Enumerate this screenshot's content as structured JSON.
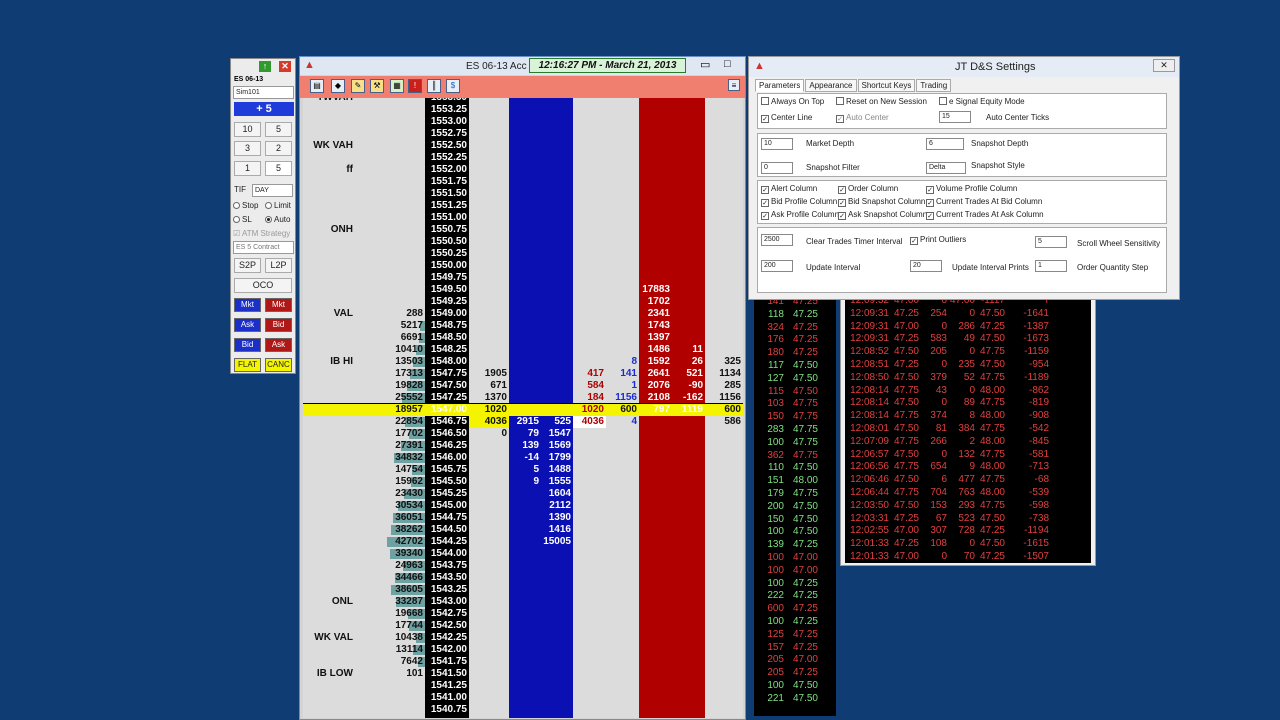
{
  "order_panel": {
    "instrument": "ES 06-13",
    "account": "Sim101",
    "position": "+ 5",
    "quantities": [
      "10",
      "5",
      "3",
      "2",
      "1"
    ],
    "quantity_value": "5",
    "tif_label": "TIF",
    "tif": "DAY",
    "stop_label": "Stop",
    "limit_label": "Limit",
    "sl_label": "SL",
    "auto_label": "Auto",
    "atm_label": "ATM Strategy",
    "contract_select": "ES 5 Contract",
    "s2p": "S2P",
    "l2p": "L2P",
    "oco": "OCO",
    "mkt_buy": "Mkt",
    "mkt_sell": "Mkt",
    "ask_buy": "Ask",
    "bid_sell": "Bid",
    "bid_buy": "Bid",
    "ask_sell": "Ask",
    "flat": "FLAT",
    "cancel": "CANC"
  },
  "dom": {
    "title": "ES 06-13   Acc",
    "clock": "12:16:27 PM - March 21, 2013",
    "rows": [
      {
        "lbl": "TWVAH",
        "vol": "",
        "p": "1553.50"
      },
      {
        "lbl": "",
        "vol": "",
        "p": "1553.25"
      },
      {
        "lbl": "",
        "vol": "",
        "p": "1553.00"
      },
      {
        "lbl": "",
        "vol": "",
        "p": "1552.75"
      },
      {
        "lbl": "WK VAH",
        "vol": "",
        "p": "1552.50"
      },
      {
        "lbl": "",
        "vol": "",
        "p": "1552.25"
      },
      {
        "lbl": "ff",
        "vol": "",
        "p": "1552.00"
      },
      {
        "lbl": "",
        "vol": "",
        "p": "1551.75"
      },
      {
        "lbl": "",
        "vol": "",
        "p": "1551.50"
      },
      {
        "lbl": "",
        "vol": "",
        "p": "1551.25"
      },
      {
        "lbl": "",
        "vol": "",
        "p": "1551.00"
      },
      {
        "lbl": "ONH",
        "vol": "",
        "p": "1550.75"
      },
      {
        "lbl": "",
        "vol": "",
        "p": "1550.50"
      },
      {
        "lbl": "",
        "vol": "",
        "p": "1550.25"
      },
      {
        "lbl": "",
        "vol": "",
        "p": "1550.00"
      },
      {
        "lbl": "",
        "vol": "",
        "p": "1549.75"
      },
      {
        "lbl": "",
        "vol": "",
        "p": "1549.50",
        "ask": "17883"
      },
      {
        "lbl": "",
        "vol": "",
        "p": "1549.25",
        "ask": "1702"
      },
      {
        "lbl": "VAL",
        "vol": "288",
        "p": "1549.00",
        "ask": "2341"
      },
      {
        "lbl": "",
        "vol": "5217",
        "p": "1548.75",
        "ask": "1743"
      },
      {
        "lbl": "",
        "vol": "6691",
        "p": "1548.50",
        "ask": "1397"
      },
      {
        "lbl": "",
        "vol": "10410",
        "p": "1548.25",
        "ask": "1486",
        "ak2": "11"
      },
      {
        "lbl": "IB HI",
        "vol": "13503",
        "p": "1548.00",
        "s2": "8",
        "ask": "1592",
        "ak2": "26",
        "r": "325"
      },
      {
        "lbl": "",
        "vol": "17313",
        "p": "1547.75",
        "o": "1905",
        "s1": "417",
        "s2": "141",
        "ask": "2641",
        "ak2": "521",
        "r": "1134"
      },
      {
        "lbl": "",
        "vol": "19828",
        "p": "1547.50",
        "o": "671",
        "s1": "584",
        "s2": "1",
        "ask": "2076",
        "ak2": "-90",
        "r": "285"
      },
      {
        "lbl": "",
        "vol": "25552",
        "p": "1547.25",
        "o": "1370",
        "s1": "184",
        "s2": "1156",
        "ask": "2108",
        "ak2": "-162",
        "r": "1156"
      },
      {
        "lbl": "",
        "vol": "18957",
        "p": "1547.00",
        "o": "1020",
        "s1": "1020",
        "s2": "600",
        "ask": "797",
        "ak2": "1119",
        "r": "600",
        "hl": true
      },
      {
        "lbl": "",
        "vol": "22854",
        "p": "1546.75",
        "o": "4036",
        "b1": "2915",
        "b2": "525",
        "s1": "4036",
        "s2": "4",
        "r": "586"
      },
      {
        "lbl": "",
        "vol": "17702",
        "p": "1546.50",
        "o": "0",
        "b1": "79",
        "b2": "1547"
      },
      {
        "lbl": "",
        "vol": "27391",
        "p": "1546.25",
        "b1": "139",
        "b2": "1569"
      },
      {
        "lbl": "",
        "vol": "34832",
        "p": "1546.00",
        "b1": "-14",
        "b2": "1799"
      },
      {
        "lbl": "",
        "vol": "14754",
        "p": "1545.75",
        "b1": "5",
        "b2": "1488"
      },
      {
        "lbl": "",
        "vol": "15962",
        "p": "1545.50",
        "b1": "9",
        "b2": "1555"
      },
      {
        "lbl": "",
        "vol": "23430",
        "p": "1545.25",
        "b2": "1604"
      },
      {
        "lbl": "",
        "vol": "30534",
        "p": "1545.00",
        "b2": "2112"
      },
      {
        "lbl": "",
        "vol": "36051",
        "p": "1544.75",
        "b2": "1390"
      },
      {
        "lbl": "",
        "vol": "38262",
        "p": "1544.50",
        "b2": "1416"
      },
      {
        "lbl": "",
        "vol": "42702",
        "p": "1544.25",
        "b2": "15005"
      },
      {
        "lbl": "",
        "vol": "39340",
        "p": "1544.00"
      },
      {
        "lbl": "",
        "vol": "24963",
        "p": "1543.75"
      },
      {
        "lbl": "",
        "vol": "34466",
        "p": "1543.50"
      },
      {
        "lbl": "",
        "vol": "38605",
        "p": "1543.25"
      },
      {
        "lbl": "ONL",
        "vol": "33287",
        "p": "1543.00"
      },
      {
        "lbl": "",
        "vol": "19668",
        "p": "1542.75"
      },
      {
        "lbl": "",
        "vol": "17744",
        "p": "1542.50"
      },
      {
        "lbl": "WK VAL",
        "vol": "10438",
        "p": "1542.25"
      },
      {
        "lbl": "",
        "vol": "13114",
        "p": "1542.00"
      },
      {
        "lbl": "",
        "vol": "7642",
        "p": "1541.75"
      },
      {
        "lbl": "IB LOW",
        "vol": "101",
        "p": "1541.50"
      },
      {
        "lbl": "",
        "vol": "",
        "p": "1541.25"
      },
      {
        "lbl": "",
        "vol": "",
        "p": "1541.00"
      },
      {
        "lbl": "",
        "vol": "",
        "p": "1540.75"
      }
    ]
  },
  "tns_left": [
    [
      "141",
      "47.25",
      "r"
    ],
    [
      "118",
      "47.25",
      "g"
    ],
    [
      "324",
      "47.25",
      "r"
    ],
    [
      "176",
      "47.25",
      "r"
    ],
    [
      "180",
      "47.25",
      "r"
    ],
    [
      "117",
      "47.50",
      "g"
    ],
    [
      "127",
      "47.50",
      "g"
    ],
    [
      "115",
      "47.50",
      "r"
    ],
    [
      "103",
      "47.75",
      "r"
    ],
    [
      "150",
      "47.75",
      "r"
    ],
    [
      "283",
      "47.75",
      "g"
    ],
    [
      "100",
      "47.75",
      "g"
    ],
    [
      "362",
      "47.75",
      "r"
    ],
    [
      "110",
      "47.50",
      "g"
    ],
    [
      "151",
      "48.00",
      "g"
    ],
    [
      "179",
      "47.75",
      "g"
    ],
    [
      "200",
      "47.50",
      "g"
    ],
    [
      "150",
      "47.50",
      "g"
    ],
    [
      "100",
      "47.50",
      "g"
    ],
    [
      "139",
      "47.25",
      "g"
    ],
    [
      "100",
      "47.00",
      "r"
    ],
    [
      "100",
      "47.00",
      "r"
    ],
    [
      "100",
      "47.25",
      "g"
    ],
    [
      "222",
      "47.25",
      "g"
    ],
    [
      "600",
      "47.25",
      "r"
    ],
    [
      "100",
      "47.25",
      "g"
    ],
    [
      "125",
      "47.25",
      "r"
    ],
    [
      "157",
      "47.25",
      "r"
    ],
    [
      "205",
      "47.00",
      "r"
    ],
    [
      "205",
      "47.25",
      "r"
    ],
    [
      "100",
      "47.50",
      "g"
    ],
    [
      "221",
      "47.50",
      "g"
    ]
  ],
  "tns_right": [
    [
      "12:09:32",
      "47.00",
      "0",
      "47.00",
      "-1117",
      "r"
    ],
    [
      "12:09:31",
      "47.25",
      "254",
      "0",
      "47.50",
      "-1641",
      "r"
    ],
    [
      "12:09:31",
      "47.00",
      "0",
      "286",
      "47.25",
      "-1387",
      "g"
    ],
    [
      "12:09:31",
      "47.25",
      "583",
      "49",
      "47.50",
      "-1673",
      "r"
    ],
    [
      "12:08:52",
      "47.50",
      "205",
      "0",
      "47.75",
      "-1159",
      "r"
    ],
    [
      "12:08:51",
      "47.25",
      "0",
      "235",
      "47.50",
      "-954",
      "g"
    ],
    [
      "12:08:50",
      "47.50",
      "379",
      "52",
      "47.75",
      "-1189",
      "r"
    ],
    [
      "12:08:14",
      "47.75",
      "43",
      "0",
      "48.00",
      "-862",
      "r"
    ],
    [
      "12:08:14",
      "47.50",
      "0",
      "89",
      "47.75",
      "-819",
      "g"
    ],
    [
      "12:08:14",
      "47.75",
      "374",
      "8",
      "48.00",
      "-908",
      "r"
    ],
    [
      "12:08:01",
      "47.50",
      "81",
      "384",
      "47.75",
      "-542",
      "g"
    ],
    [
      "12:07:09",
      "47.75",
      "266",
      "2",
      "48.00",
      "-845",
      "r"
    ],
    [
      "12:06:57",
      "47.50",
      "0",
      "132",
      "47.75",
      "-581",
      "g"
    ],
    [
      "12:06:56",
      "47.75",
      "654",
      "9",
      "48.00",
      "-713",
      "r"
    ],
    [
      "12:06:46",
      "47.50",
      "6",
      "477",
      "47.75",
      "-68",
      "g"
    ],
    [
      "12:06:44",
      "47.75",
      "704",
      "763",
      "48.00",
      "-539",
      "r"
    ],
    [
      "12:03:50",
      "47.50",
      "153",
      "293",
      "47.75",
      "-598",
      "g"
    ],
    [
      "12:03:31",
      "47.25",
      "67",
      "523",
      "47.50",
      "-738",
      "g"
    ],
    [
      "12:02:55",
      "47.00",
      "307",
      "728",
      "47.25",
      "-1194",
      "g"
    ],
    [
      "12:01:33",
      "47.25",
      "108",
      "0",
      "47.50",
      "-1615",
      "r"
    ],
    [
      "12:01:33",
      "47.00",
      "0",
      "70",
      "47.25",
      "-1507",
      "g"
    ]
  ],
  "settings": {
    "title": "JT D&S Settings",
    "tabs": [
      "Parameters",
      "Appearance",
      "Shortcut Keys",
      "Trading"
    ],
    "always_on_top": "Always On Top",
    "reset_session": "Reset on New Session",
    "esignal": "e Signal Equity Mode",
    "center_line": "Center Line",
    "auto_center": "Auto Center",
    "auto_center_ticks_val": "15",
    "auto_center_ticks": "Auto Center Ticks",
    "market_depth_val": "10",
    "market_depth": "Market Depth",
    "snapshot_depth_val": "6",
    "snapshot_depth": "Snapshot Depth",
    "snapshot_filter_val": "0",
    "snapshot_filter": "Snapshot Filter",
    "snapshot_style_val": "Delta",
    "snapshot_style": "Snapshot Style",
    "alert_col": "Alert Column",
    "order_col": "Order Column",
    "volprof_col": "Volume Profile Column",
    "bidprof_col": "Bid Profile Column",
    "bidsnap_col": "Bid Snapshot Column",
    "cur_bid": "Current Trades At Bid Column",
    "askprof_col": "Ask Profile Column",
    "asksnap_col": "Ask Snapshot Column",
    "cur_ask": "Current Trades At Ask Column",
    "clear_timer_val": "2500",
    "clear_timer": "Clear Trades Timer Interval",
    "print_outliers": "Print Outliers",
    "scroll_val": "5",
    "scroll": "Scroll Wheel Sensitivity",
    "update_val": "200",
    "update": "Update Interval",
    "update_prints_val": "20",
    "update_prints": "Update Interval Prints",
    "qty_step_val": "1",
    "qty_step": "Order Quantity Step"
  }
}
